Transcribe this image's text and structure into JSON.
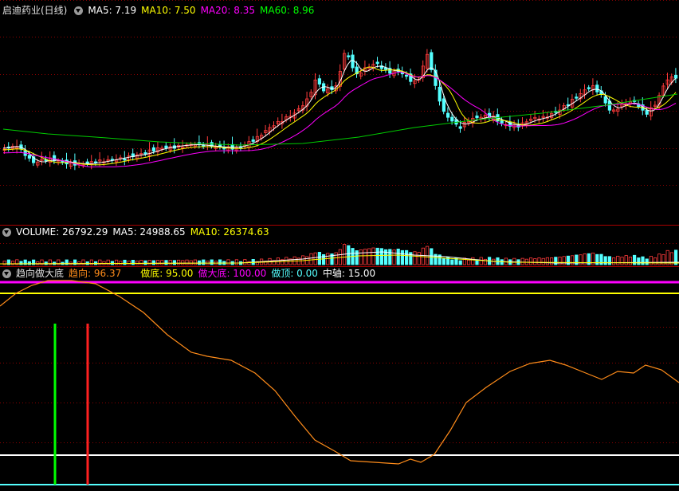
{
  "colors": {
    "up": "#ff3b3b",
    "down": "#54ffff",
    "ma5": "#ffffff",
    "ma10": "#ffff00",
    "ma20": "#ff00ff",
    "ma60": "#00cc00",
    "grid": "#8b0000",
    "trend": "#ff8c1a",
    "bottom": "#ffff00",
    "big_bottom": "#ff00ff",
    "top": "#54ffff",
    "axis": "#ffffff"
  },
  "price_panel": {
    "title": "启迪药业(日线)",
    "ma5_label": "MA5: 7.19",
    "ma10_label": "MA10: 7.50",
    "ma20_label": "MA20: 8.35",
    "ma60_label": "MA60: 8.96"
  },
  "volume_panel": {
    "volume_label": "VOLUME: 26792.29",
    "ma5_label": "MA5: 24988.65",
    "ma10_label": "MA10: 26374.63"
  },
  "indicator_panel": {
    "name": "趋向做大底",
    "trend_label": "趋向: 96.37",
    "bottom_label": "做底: 95.00",
    "big_bottom_label": "做大底: 100.00",
    "top_label": "做顶: 0.00",
    "axis_label": "中轴: 15.00"
  },
  "chart_data": [
    {
      "type": "candlestick",
      "title": "启迪药业(日线)",
      "series": [
        {
          "name": "MA5",
          "value": 7.19
        },
        {
          "name": "MA10",
          "value": 7.5
        },
        {
          "name": "MA20",
          "value": 8.35
        },
        {
          "name": "MA60",
          "value": 8.96
        }
      ]
    },
    {
      "type": "bar",
      "series": [
        {
          "name": "VOLUME",
          "value": 26792.29
        },
        {
          "name": "MA5",
          "value": 24988.65
        },
        {
          "name": "MA10",
          "value": 26374.63
        }
      ]
    },
    {
      "type": "line",
      "title": "趋向做大底",
      "series": [
        {
          "name": "趋向",
          "value": 96.37
        },
        {
          "name": "做底",
          "value": 95.0
        },
        {
          "name": "做大底",
          "value": 100.0
        },
        {
          "name": "做顶",
          "value": 0.0
        },
        {
          "name": "中轴",
          "value": 15.0
        }
      ]
    }
  ]
}
